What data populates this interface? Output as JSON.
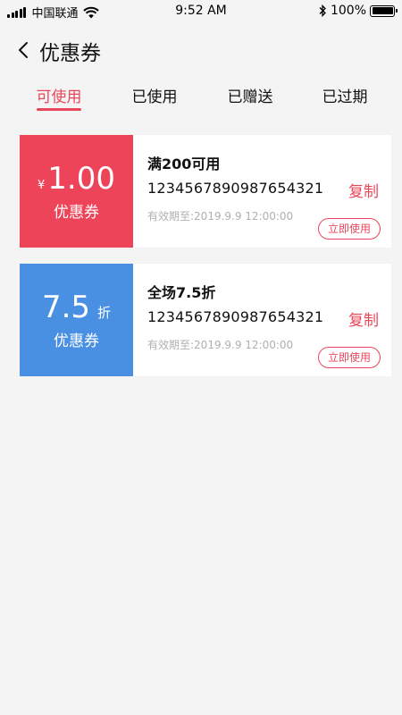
{
  "status_bar": {
    "carrier": "中国联通",
    "time": "9:52 AM",
    "battery": "100%",
    "battery_level": 1.0
  },
  "header": {
    "title": "优惠券"
  },
  "tabs": [
    {
      "label": "可使用",
      "active": true
    },
    {
      "label": "已使用",
      "active": false
    },
    {
      "label": "已赠送",
      "active": false
    },
    {
      "label": "已过期",
      "active": false
    }
  ],
  "colors": {
    "accent": "#e8475b",
    "coupon_red": "#ee445a",
    "coupon_blue": "#4a90e2"
  },
  "coupons": [
    {
      "currency": "¥",
      "amount": "1.00",
      "unit": "",
      "label": "优惠券",
      "title": "满200可用",
      "code": "1234567890987654321",
      "copy_label": "复制",
      "expiry": "有效期至:2019.9.9 12:00:00",
      "use_label": "立即使用"
    },
    {
      "currency": "",
      "amount": "7.5",
      "unit": "折",
      "label": "优惠券",
      "title": "全场7.5折",
      "code": "1234567890987654321",
      "copy_label": "复制",
      "expiry": "有效期至:2019.9.9 12:00:00",
      "use_label": "立即使用"
    }
  ]
}
